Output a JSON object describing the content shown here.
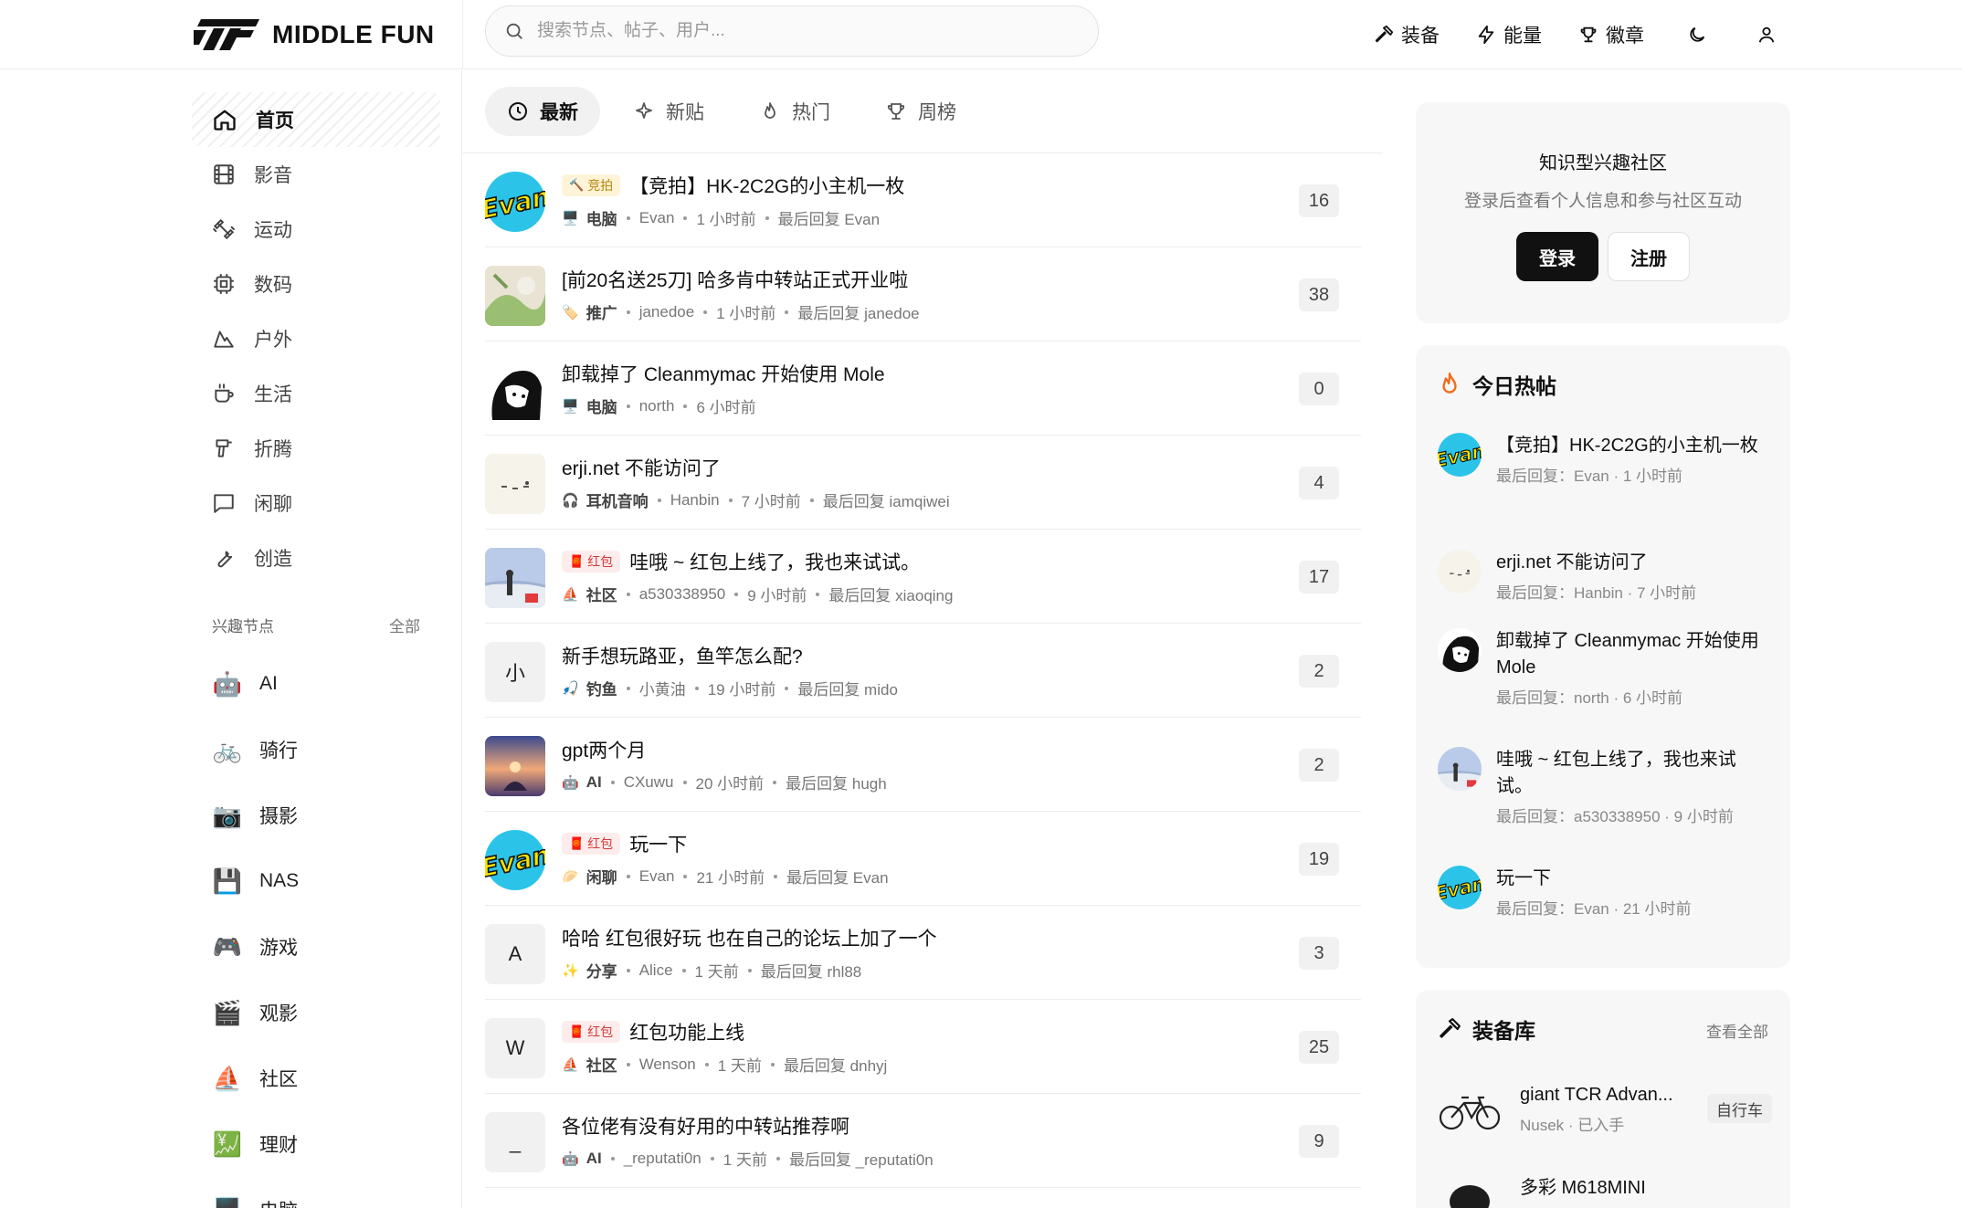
{
  "brand": {
    "name": "MIDDLE FUN"
  },
  "search": {
    "placeholder": "搜索节点、帖子、用户..."
  },
  "top_nav": [
    {
      "label": "装备",
      "icon": "hammer-icon"
    },
    {
      "label": "能量",
      "icon": "bolt-icon"
    },
    {
      "label": "徽章",
      "icon": "trophy-icon"
    }
  ],
  "sidebar": {
    "items": [
      {
        "label": "首页",
        "icon": "home-icon"
      },
      {
        "label": "影音",
        "icon": "film-icon"
      },
      {
        "label": "运动",
        "icon": "dumbbell-icon"
      },
      {
        "label": "数码",
        "icon": "chip-icon"
      },
      {
        "label": "户外",
        "icon": "mountain-icon"
      },
      {
        "label": "生活",
        "icon": "cup-icon"
      },
      {
        "label": "折腾",
        "icon": "drill-icon"
      },
      {
        "label": "闲聊",
        "icon": "chat-icon"
      },
      {
        "label": "创造",
        "icon": "wrench-icon"
      }
    ],
    "nodes_title": "兴趣节点",
    "nodes_all": "全部",
    "nodes": [
      {
        "label": "AI",
        "emoji": "🤖"
      },
      {
        "label": "骑行",
        "emoji": "🚲"
      },
      {
        "label": "摄影",
        "emoji": "📷"
      },
      {
        "label": "NAS",
        "emoji": "💾"
      },
      {
        "label": "游戏",
        "emoji": "🎮"
      },
      {
        "label": "观影",
        "emoji": "🎬"
      },
      {
        "label": "社区",
        "emoji": "⛵"
      },
      {
        "label": "理财",
        "emoji": "💹"
      },
      {
        "label": "电脑",
        "emoji": "🖥️"
      }
    ]
  },
  "tabs": [
    {
      "label": "最新",
      "icon": "clock-icon"
    },
    {
      "label": "新贴",
      "icon": "sparkle-icon"
    },
    {
      "label": "热门",
      "icon": "flame-icon"
    },
    {
      "label": "周榜",
      "icon": "trophy-icon"
    }
  ],
  "posts": [
    {
      "badge": "竞拍",
      "badge_type": "gold",
      "title": "【竞拍】HK-2C2G的小主机一枚",
      "node": "电脑",
      "node_emoji": "🖥️",
      "author": "Evan",
      "time": "1 小时前",
      "last_reply": "最后回复 Evan",
      "count": "16",
      "avatar": "evan"
    },
    {
      "badge": "",
      "title": "[前20名送25刀] 哈多肯中转站正式开业啦",
      "node": "推广",
      "node_emoji": "🏷️",
      "author": "janedoe",
      "time": "1 小时前",
      "last_reply": "最后回复 janedoe",
      "count": "38",
      "avatar": "art"
    },
    {
      "badge": "",
      "title": "卸载掉了 Cleanmymac 开始使用 Mole",
      "node": "电脑",
      "node_emoji": "🖥️",
      "author": "north",
      "time": "6 小时前",
      "last_reply": "",
      "count": "0",
      "avatar": "manga"
    },
    {
      "badge": "",
      "title": "erji.net 不能访问了",
      "node": "耳机音响",
      "node_emoji": "🎧",
      "author": "Hanbin",
      "time": "7 小时前",
      "last_reply": "最后回复 iamqiwei",
      "count": "4",
      "avatar": "face"
    },
    {
      "badge": "红包",
      "badge_type": "red",
      "title": "哇哦 ~ 红包上线了，我也来试试。",
      "node": "社区",
      "node_emoji": "⛵",
      "author": "a530338950",
      "time": "9 小时前",
      "last_reply": "最后回复 xiaoqing",
      "count": "17",
      "avatar": "sky"
    },
    {
      "badge": "",
      "title": "新手想玩路亚，鱼竿怎么配?",
      "node": "钓鱼",
      "node_emoji": "🎣",
      "author": "小黄油",
      "time": "19 小时前",
      "last_reply": "最后回复 mido",
      "count": "2",
      "avatar": "letter",
      "letter": "小"
    },
    {
      "badge": "",
      "title": "gpt两个月",
      "node": "AI",
      "node_emoji": "🤖",
      "author": "CXuwu",
      "time": "20 小时前",
      "last_reply": "最后回复 hugh",
      "count": "2",
      "avatar": "sunset"
    },
    {
      "badge": "红包",
      "badge_type": "red",
      "title": "玩一下",
      "node": "闲聊",
      "node_emoji": "🥟",
      "author": "Evan",
      "time": "21 小时前",
      "last_reply": "最后回复 Evan",
      "count": "19",
      "avatar": "evan"
    },
    {
      "badge": "",
      "title": "哈哈 红包很好玩 也在自己的论坛上加了一个",
      "node": "分享",
      "node_emoji": "✨",
      "author": "Alice",
      "time": "1 天前",
      "last_reply": "最后回复 rhl88",
      "count": "3",
      "avatar": "letter",
      "letter": "A"
    },
    {
      "badge": "红包",
      "badge_type": "red",
      "title": "红包功能上线",
      "node": "社区",
      "node_emoji": "⛵",
      "author": "Wenson",
      "time": "1 天前",
      "last_reply": "最后回复 dnhyj",
      "count": "25",
      "avatar": "letter",
      "letter": "W"
    },
    {
      "badge": "",
      "title": "各位佬有没有好用的中转站推荐啊",
      "node": "AI",
      "node_emoji": "🤖",
      "author": "_reputati0n",
      "time": "1 天前",
      "last_reply": "最后回复 _reputati0n",
      "count": "9",
      "avatar": "letter",
      "letter": "_"
    }
  ],
  "login_card": {
    "title": "知识型兴趣社区",
    "subtitle": "登录后查看个人信息和参与社区互动",
    "login_label": "登录",
    "register_label": "注册"
  },
  "hot_today": {
    "title": "今日热帖",
    "items": [
      {
        "title": "【竞拍】HK-2C2G的小主机一枚",
        "meta": "最后回复：Evan · 1 小时前",
        "avatar": "evan"
      },
      {
        "title": "erji.net 不能访问了",
        "meta": "最后回复：Hanbin · 7 小时前",
        "avatar": "face"
      },
      {
        "title": "卸载掉了 Cleanmymac 开始使用 Mole",
        "meta": "最后回复：north · 6 小时前",
        "avatar": "manga"
      },
      {
        "title": "哇哦 ~ 红包上线了，我也来试试。",
        "meta": "最后回复：a530338950 · 9 小时前",
        "avatar": "sky"
      },
      {
        "title": "玩一下",
        "meta": "最后回复：Evan · 21 小时前",
        "avatar": "evan"
      }
    ]
  },
  "gear": {
    "title": "装备库",
    "view_all": "查看全部",
    "items": [
      {
        "name": "giant TCR Advan...",
        "sub": "Nusek · 已入手",
        "tag": "自行车"
      },
      {
        "name": "多彩 M618MINI",
        "sub": "",
        "tag": ""
      }
    ]
  },
  "colors": {
    "accent": "#111111",
    "badge_red": "#d63b3b",
    "badge_gold": "#b8860b",
    "flame": "#f26b1d"
  }
}
